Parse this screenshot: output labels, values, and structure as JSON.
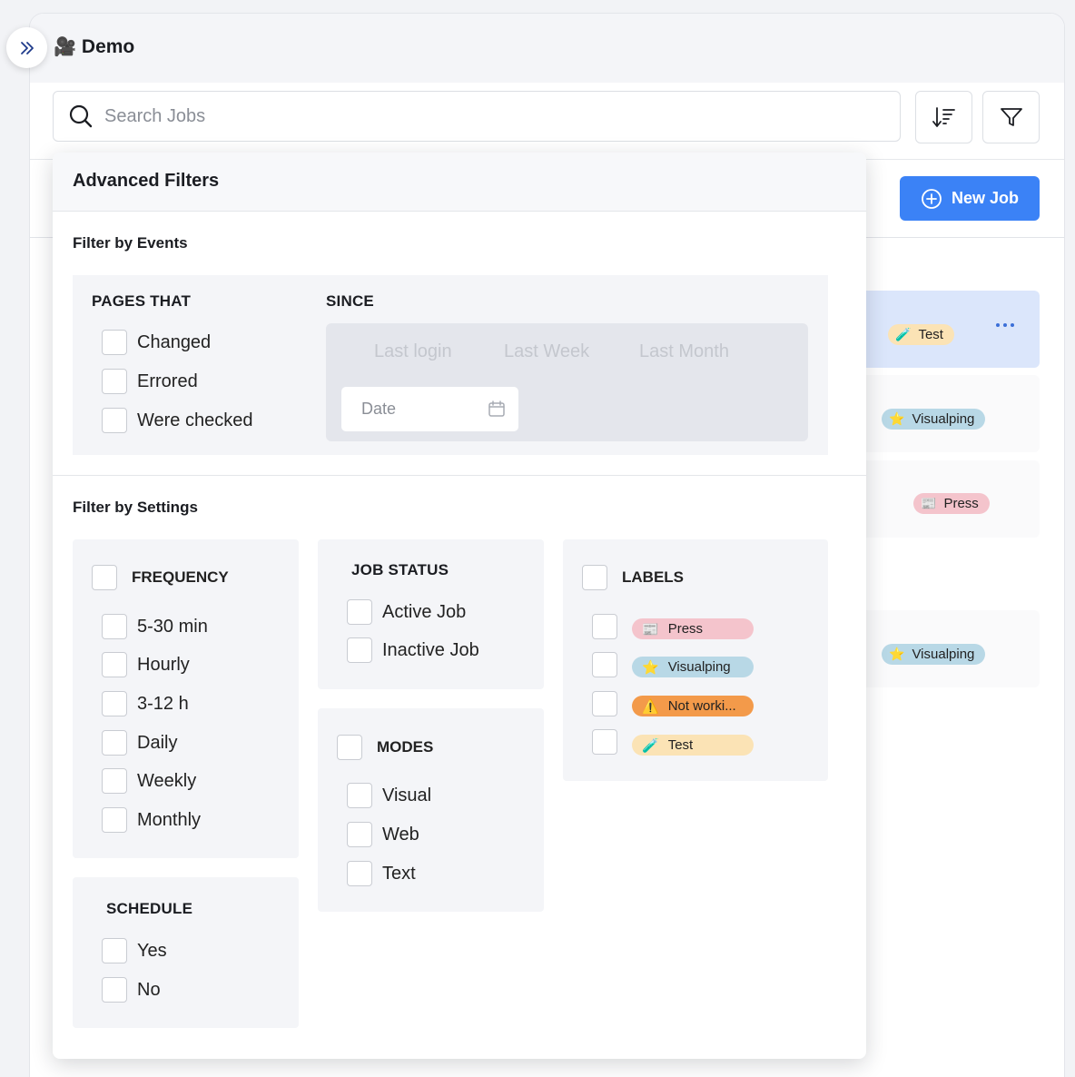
{
  "app": {
    "title": "Demo",
    "title_icon": "video-camera-icon"
  },
  "search": {
    "placeholder": "Search Jobs"
  },
  "toolbar": {
    "sort_icon": "sort-icon",
    "filter_icon": "filter-icon",
    "new_job_label": "New Job"
  },
  "jobs_visible": [
    {
      "label": "Test",
      "emoji": "🧪",
      "selected": true
    },
    {
      "label": "Visualping",
      "emoji": "⭐"
    },
    {
      "label": "Press",
      "emoji": "📰"
    },
    {
      "label": "Visualping",
      "emoji": "⭐"
    }
  ],
  "filters": {
    "title": "Advanced Filters",
    "events": {
      "title": "Filter by Events",
      "pages_that": {
        "title": "PAGES THAT",
        "options": [
          "Changed",
          "Errored",
          "Were checked"
        ]
      },
      "since": {
        "title": "SINCE",
        "options": [
          "Last login",
          "Last Week",
          "Last Month"
        ],
        "date_placeholder": "Date"
      }
    },
    "settings": {
      "title": "Filter by Settings",
      "frequency": {
        "title": "FREQUENCY",
        "options": [
          "5-30 min",
          "Hourly",
          "3-12 h",
          "Daily",
          "Weekly",
          "Monthly"
        ]
      },
      "schedule": {
        "title": "SCHEDULE",
        "options": [
          "Yes",
          "No"
        ]
      },
      "job_status": {
        "title": "JOB STATUS",
        "options": [
          "Active Job",
          "Inactive Job"
        ]
      },
      "modes": {
        "title": "MODES",
        "options": [
          "Visual",
          "Web",
          "Text"
        ]
      },
      "labels": {
        "title": "LABELS",
        "options": [
          {
            "emoji": "📰",
            "label": "Press",
            "color": "#f4c4cc"
          },
          {
            "emoji": "⭐",
            "label": "Visualping",
            "color": "#b8d8e6"
          },
          {
            "emoji": "⚠️",
            "label": "Not worki...",
            "color": "#f39a4a"
          },
          {
            "emoji": "🧪",
            "label": "Test",
            "color": "#fbe3b5"
          }
        ]
      }
    }
  },
  "colors": {
    "primary": "#3b82f6",
    "panel_bg": "#f4f5f8"
  }
}
